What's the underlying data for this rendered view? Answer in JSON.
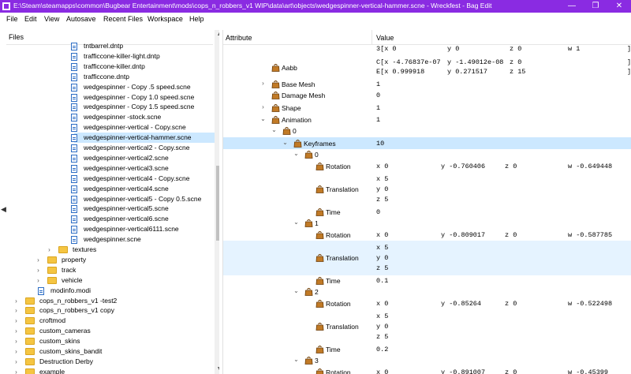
{
  "window": {
    "title": "E:\\Steam\\steamapps\\common\\Bugbear Entertainment\\mods\\cops_n_robbers_v1  WIP\\data\\art\\objects\\wedgespinner-vertical-hammer.scne - Wreckfest - Bag Edit",
    "minimize": "—",
    "maximize": "❐",
    "close": "✕"
  },
  "menu": [
    "File",
    "Edit",
    "View",
    "Autosave",
    "Recent Files",
    "Workspace",
    "Help"
  ],
  "files_panel": {
    "header": "Files",
    "items": [
      {
        "label": "tntbarrel.dntp",
        "type": "file"
      },
      {
        "label": "trafficcone-killer-light.dntp",
        "type": "file"
      },
      {
        "label": "trafficcone-killer.dntp",
        "type": "file"
      },
      {
        "label": "trafficcone.dntp",
        "type": "file"
      },
      {
        "label": "wedgespinner - Copy .5 speed.scne",
        "type": "file"
      },
      {
        "label": "wedgespinner - Copy 1.0 speed.scne",
        "type": "file"
      },
      {
        "label": "wedgespinner - Copy 1.5 speed.scne",
        "type": "file"
      },
      {
        "label": "wedgespinner -stock.scne",
        "type": "file"
      },
      {
        "label": "wedgespinner-vertical - Copy.scne",
        "type": "file"
      },
      {
        "label": "wedgespinner-vertical-hammer.scne",
        "type": "file",
        "selected": true
      },
      {
        "label": "wedgespinner-vertical2 - Copy.scne",
        "type": "file"
      },
      {
        "label": "wedgespinner-vertical2.scne",
        "type": "file"
      },
      {
        "label": "wedgespinner-vertical3.scne",
        "type": "file"
      },
      {
        "label": "wedgespinner-vertical4 - Copy.scne",
        "type": "file"
      },
      {
        "label": "wedgespinner-vertical4.scne",
        "type": "file"
      },
      {
        "label": "wedgespinner-vertical5 - Copy 0.5.scne",
        "type": "file"
      },
      {
        "label": "wedgespinner-vertical5.scne",
        "type": "file"
      },
      {
        "label": "wedgespinner-vertical6.scne",
        "type": "file"
      },
      {
        "label": "wedgespinner-vertical6111.scne",
        "type": "file"
      },
      {
        "label": "wedgespinner.scne",
        "type": "file"
      },
      {
        "label": "textures",
        "type": "folder"
      },
      {
        "label": "property",
        "type": "folder"
      },
      {
        "label": "track",
        "type": "folder"
      },
      {
        "label": "vehicle",
        "type": "folder"
      },
      {
        "label": "modinfo.modi",
        "type": "file"
      },
      {
        "label": "cops_n_robbers_v1 -test2",
        "type": "folder"
      },
      {
        "label": "cops_n_robbers_v1 copy",
        "type": "folder"
      },
      {
        "label": "croftmod",
        "type": "folder"
      },
      {
        "label": "custom_cameras",
        "type": "folder"
      },
      {
        "label": "custom_skins",
        "type": "folder"
      },
      {
        "label": "custom_skins_bandit",
        "type": "folder"
      },
      {
        "label": "Destruction Derby",
        "type": "folder"
      },
      {
        "label": "example",
        "type": "folder"
      }
    ]
  },
  "attributes_panel": {
    "header_attr": "Attribute",
    "header_value": "Value",
    "top_partial": {
      "a": "3[x 0",
      "b": "y 0",
      "c": "z 0",
      "d": "w 1",
      "e": "]"
    },
    "rows": [
      {
        "name": "Aabb",
        "lines": [
          {
            "a": "C[x -4.76837e-07",
            "b": "y -1.49012e-08",
            "c": "z 0",
            "e": "]"
          },
          {
            "a": "E[x 0.999918",
            "b": "y 0.271517",
            "c": "z 15",
            "e": "]"
          }
        ]
      },
      {
        "name": "Base Mesh",
        "value": "1"
      },
      {
        "name": "Damage Mesh",
        "value": "0"
      },
      {
        "name": "Shape",
        "value": "1"
      },
      {
        "name": "Animation",
        "value": "1"
      },
      {
        "name": "0",
        "value": ""
      },
      {
        "name": "Keyframes",
        "value": "10"
      },
      {
        "name": "0",
        "value": ""
      },
      {
        "name": "Rotation",
        "quat": {
          "x": "x 0",
          "y": "y -0.760406",
          "z": "z 0",
          "w": "w -0.649448"
        }
      },
      {
        "name": "Translation",
        "vec": [
          "x 5",
          "y 0",
          "z 5"
        ]
      },
      {
        "name": "Time",
        "value": "0"
      },
      {
        "name": "1",
        "value": ""
      },
      {
        "name": "Rotation",
        "quat": {
          "x": "x 0",
          "y": "y -0.809017",
          "z": "z 0",
          "w": "w -0.587785"
        }
      },
      {
        "name": "Translation",
        "vec": [
          "x 5",
          "y 0",
          "z 5"
        ]
      },
      {
        "name": "Time",
        "value": "0.1"
      },
      {
        "name": "2",
        "value": ""
      },
      {
        "name": "Rotation",
        "quat": {
          "x": "x 0",
          "y": "y -0.85264",
          "z": "z 0",
          "w": "w -0.522498"
        }
      },
      {
        "name": "Translation",
        "vec": [
          "x 5",
          "y 0",
          "z 5"
        ]
      },
      {
        "name": "Time",
        "value": "0.2"
      },
      {
        "name": "3",
        "value": ""
      },
      {
        "name": "Rotation",
        "quat": {
          "x": "x 0",
          "y": "y -0.891007",
          "z": "z 0",
          "w": "w -0.45399"
        }
      }
    ]
  }
}
